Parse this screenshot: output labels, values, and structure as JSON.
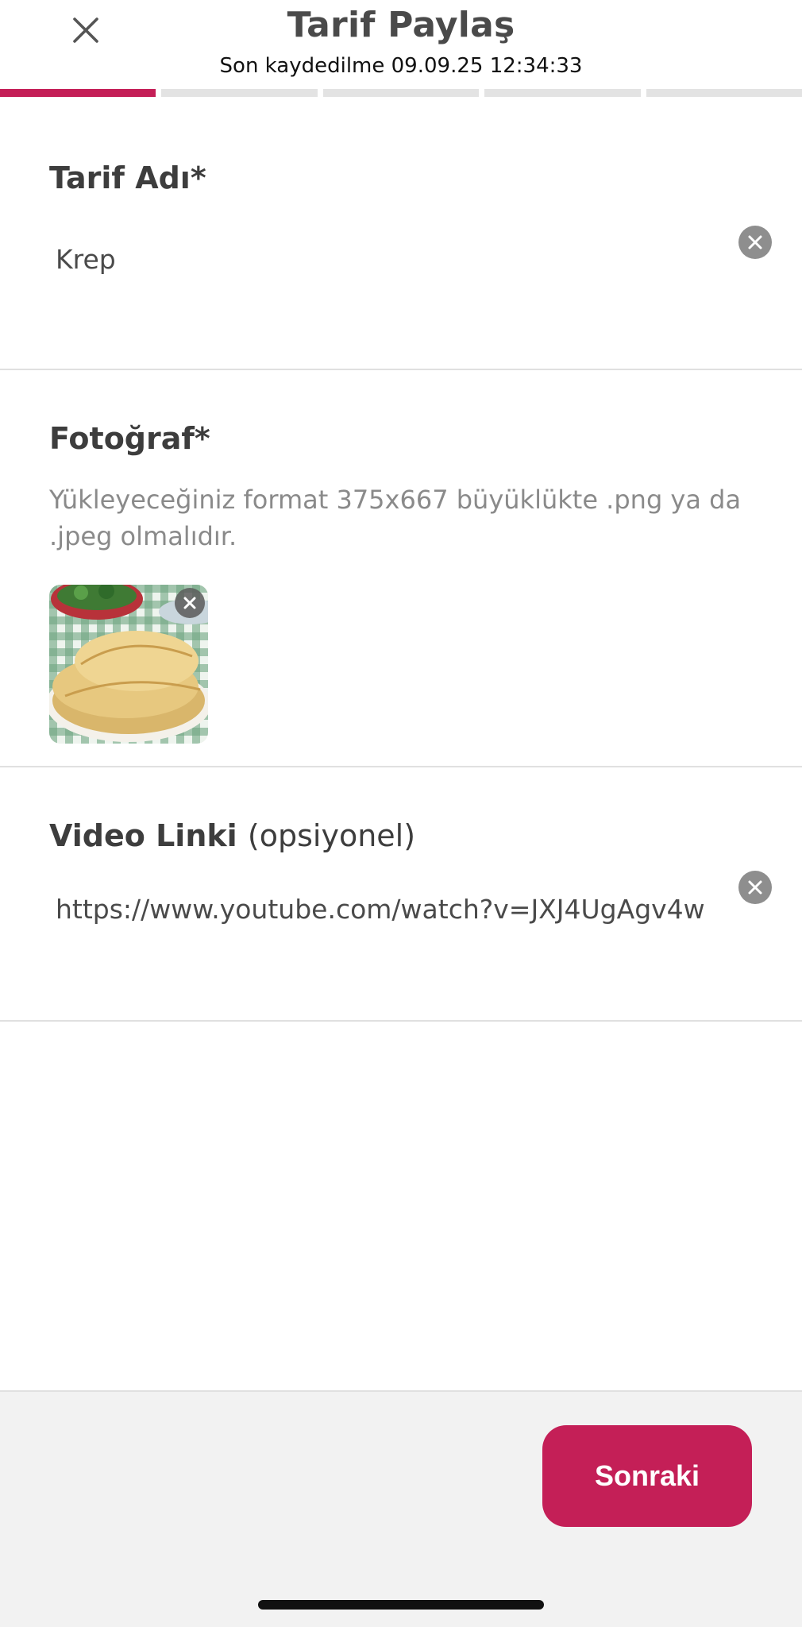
{
  "header": {
    "title": "Tarif Paylaş",
    "subtitle": "Son kaydedilme 09.09.25  12:34:33",
    "close_icon": "close-icon"
  },
  "progress": {
    "total_steps": 5,
    "current_step": 1,
    "active_color": "#c41f57"
  },
  "recipe_name": {
    "label": "Tarif Adı*",
    "value": "Krep",
    "clear_icon": "clear-icon"
  },
  "photo": {
    "label": "Fotoğraf*",
    "hint": "Yükleyeceğiniz format 375x667 büyüklükte .png ya da .jpeg olmalıdır.",
    "thumbnail_icon": "crepe-photo",
    "remove_icon": "close-icon"
  },
  "video": {
    "label": "Video Linki",
    "optional": "(opsiyonel)",
    "value": "https://www.youtube.com/watch?v=JXJ4UgAgv4w",
    "clear_icon": "clear-icon"
  },
  "footer": {
    "next_label": "Sonraki",
    "accent": "#c41f57"
  }
}
